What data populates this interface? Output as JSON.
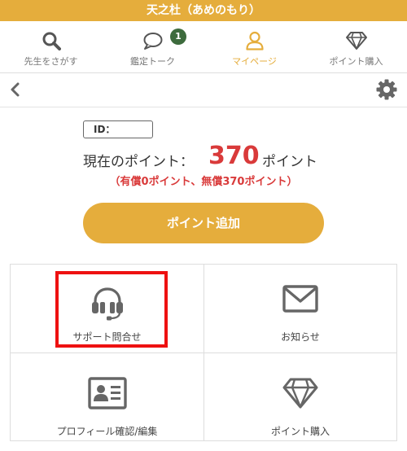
{
  "app": {
    "title": "天之杜（あめのもり）"
  },
  "colors": {
    "accent": "#e5ad3c",
    "points_red": "#d93a3a",
    "badge": "#3d6b3d",
    "highlight": "#ee1111"
  },
  "nav": {
    "tabs": [
      {
        "label": "先生をさがす",
        "icon": "search-icon"
      },
      {
        "label": "鑑定トーク",
        "icon": "chat-bubble-icon",
        "badge": "1"
      },
      {
        "label": "マイページ",
        "icon": "user-icon",
        "active": true
      },
      {
        "label": "ポイント購入",
        "icon": "diamond-icon"
      }
    ]
  },
  "toolbar": {
    "back_icon": "chevron-left-icon",
    "settings_icon": "gear-icon"
  },
  "account": {
    "id_label": "ID：",
    "points_label": "現在のポイント：",
    "points_value": "370",
    "points_unit": "ポイント",
    "points_detail": "（有償0ポイント、無償370ポイント）",
    "add_button": "ポイント追加"
  },
  "menu": {
    "items": [
      {
        "label": "サポート問合せ",
        "icon": "headset-icon"
      },
      {
        "label": "お知らせ",
        "icon": "envelope-icon"
      },
      {
        "label": "プロフィール確認/編集",
        "icon": "id-card-icon"
      },
      {
        "label": "ポイント購入",
        "icon": "diamond-icon"
      }
    ]
  }
}
